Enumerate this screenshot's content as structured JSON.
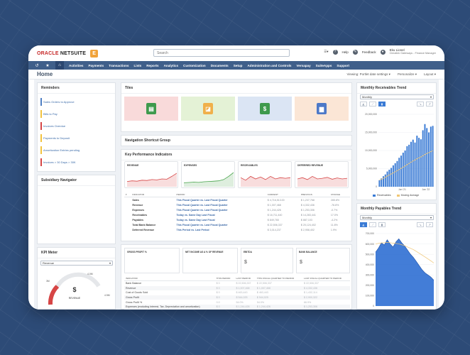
{
  "brand": {
    "oracle": "ORACLE",
    "netsuite": "NETSUITE",
    "badge": "E"
  },
  "search": {
    "placeholder": "Search"
  },
  "topbar": {
    "help": "Help",
    "feedback": "Feedback",
    "user_name": "Eku Lionel",
    "user_role": "Cimalink Gateways - Finance Manager"
  },
  "nav": {
    "items": [
      "Activities",
      "Payments",
      "Transactions",
      "Lists",
      "Reports",
      "Analytics",
      "Customization",
      "Documents",
      "Setup",
      "Administration and Controls",
      "Versapay",
      "SuiteApps",
      "Support"
    ]
  },
  "page": {
    "title": "Home",
    "actions": [
      "Viewing: Portlet date settings ▾",
      "Personalize ▾",
      "Layout ▾"
    ]
  },
  "reminders": {
    "title": "Reminders",
    "items": [
      {
        "label": "Sales Orders to Approve",
        "color": "#4f7fc4"
      },
      {
        "label": "Bills to Pay",
        "color": "#f2c33f"
      },
      {
        "label": "Invoices Overdue",
        "color": "#d64545"
      },
      {
        "label": "Payments to Deposit",
        "color": "#f2c33f"
      },
      {
        "label": "Amortization Entries pending",
        "color": "#f2c33f"
      },
      {
        "label": "Invoices > 30 Days > 30K",
        "color": "#d64545"
      }
    ]
  },
  "subsidiary": {
    "title": "Subsidiary Navigator"
  },
  "kpi_meter": {
    "title": "KPI Meter",
    "select": "Revenue",
    "value_label": "REVENUE",
    "max_label": "4.5M",
    "min_label": "3M",
    "top_label": "4.0M"
  },
  "tiles": {
    "title": "Tiles",
    "items": [
      {
        "bg": "#f9dada",
        "icon_bg": "#3f9a4d",
        "icon": "cash-register-icon"
      },
      {
        "bg": "#e4f2d6",
        "icon_bg": "#f0b04a",
        "icon": "report-chart-icon"
      },
      {
        "bg": "#dbe5f4",
        "icon_bg": "#3f9a4d",
        "icon": "money-icon"
      },
      {
        "bg": "#fbe6d6",
        "icon_bg": "#4d79c8",
        "icon": "document-icon"
      }
    ]
  },
  "nav_shortcut": {
    "title": "Navigation Shortcut Group"
  },
  "kpi": {
    "title": "Key Performance Indicators",
    "cards": [
      {
        "label": "REVENUE",
        "color": "#d64545",
        "trend": [
          0.3,
          0.35,
          0.32,
          0.4,
          0.38,
          0.45,
          0.42,
          0.5,
          0.48,
          0.7,
          0.95
        ]
      },
      {
        "label": "EXPENSES",
        "color": "#46a34a",
        "trend": [
          0.2,
          0.22,
          0.25,
          0.23,
          0.28,
          0.3,
          0.32,
          0.35,
          0.45,
          0.7,
          1.0
        ]
      },
      {
        "label": "RECEIVABLES",
        "color": "#d64545",
        "trend": [
          0.6,
          0.4,
          0.7,
          0.5,
          0.65,
          0.45,
          0.7,
          0.5,
          0.6,
          0.55,
          0.6
        ]
      },
      {
        "label": "DEFERRED REVENUE",
        "color": "#d64545",
        "trend": [
          0.5,
          0.6,
          0.45,
          0.7,
          0.5,
          0.55,
          0.62,
          0.48,
          0.58,
          0.5,
          0.55
        ]
      }
    ],
    "columns": [
      "INDICATOR",
      "PERIOD",
      "CURRENT",
      "PREVIOUS",
      "CHANGE"
    ],
    "rows": [
      {
        "indicator": "Sales",
        "period": "This Fiscal Quarter vs. Last Fiscal Quarter",
        "current": "$ 4,716,513.00",
        "previous": "$ 1,237,768",
        "change": "285.8%"
      },
      {
        "indicator": "Revenue",
        "period": "This Fiscal Quarter vs. Last Fiscal Quarter",
        "current": "$ 1,007,468",
        "previous": "$ 4,332,436",
        "change": "-76.8%"
      },
      {
        "indicator": "Expenses",
        "period": "This Fiscal Quarter vs. Last Fiscal Quarter",
        "current": "$ 1,244,426",
        "previous": "$ 1,253,306",
        "change": "-0.7%"
      },
      {
        "indicator": "Receivables",
        "period": "Today vs. Same Day Last Fiscal",
        "current": "$ 16,711,440",
        "previous": "$ 14,283,441",
        "change": "17.0%"
      },
      {
        "indicator": "Payables",
        "period": "Today vs. Same Day Last Fiscal",
        "current": "$ 849,765",
        "previous": "$ 887,103",
        "change": "-4.2%"
      },
      {
        "indicator": "Total Bank Balance",
        "period": "This Fiscal Quarter vs. Last Fiscal Quarter",
        "current": "$ 22,506,337",
        "previous": "$ 20,124,402",
        "change": "11.8%"
      },
      {
        "indicator": "Deferred Revenue",
        "period": "This Period vs. Last Period",
        "current": "$ 3,014,237",
        "previous": "$ 2,958,402",
        "change": "1.9%"
      }
    ]
  },
  "finance": {
    "cards": [
      {
        "label": "GROSS PROFIT %"
      },
      {
        "label": "NET INCOME AS A % OF REVENUE"
      },
      {
        "label": "EBITDA",
        "value": "$"
      },
      {
        "label": "BANK BALANCE",
        "value": "$"
      }
    ],
    "columns": [
      "INDICATOR",
      "THIS PERIOD",
      "LAST PERIOD",
      "THIS FISCAL QUARTER TO PERIOD",
      "LAST FISCAL QUARTER TO PERIOD"
    ],
    "rows": [
      {
        "indicator": "Bank Balance",
        "vals": [
          "$ 0",
          "$ 22,506,337",
          "$ 22,506,337",
          "$ 22,506,337"
        ]
      },
      {
        "indicator": "Revenue",
        "vals": [
          "$ 0",
          "$ 1,007,468",
          "$ 1,007,468",
          "$ 4,332,436"
        ]
      },
      {
        "indicator": "Cost of Goods Sold",
        "vals": [
          "$ 0",
          "$ 463,443",
          "$ 463,443",
          "$ 1,432,114"
        ]
      },
      {
        "indicator": "Gross Profit",
        "vals": [
          "$ 0",
          "$ 544,025",
          "$ 544,025",
          "$ 2,900,322"
        ]
      },
      {
        "indicator": "Gross Profit %",
        "vals": [
          "0.0",
          "54.0%",
          "54.0%",
          "66.9%"
        ]
      },
      {
        "indicator": "Expenses (excluding Interest, Tax, Depreciation and amortization)",
        "vals": [
          "$ 0",
          "$ 1,244,426",
          "$ 1,244,426",
          "$ 1,253,306"
        ]
      }
    ]
  },
  "receivables_trend": {
    "title": "Monthly Receivables Trend",
    "select": "Monthly",
    "legend": [
      "Receivables",
      "Moving Average"
    ],
    "bar_color": "#3a7bd5",
    "avg_color": "#f0c674"
  },
  "payables_trend": {
    "title": "Monthly Payables Trend",
    "select": "Monthly",
    "area_color": "#2f6fd3"
  },
  "chart_data": [
    {
      "type": "bar",
      "title": "Monthly Receivables Trend",
      "yticks": [
        "20,000,000",
        "15,000,000",
        "10,000,000",
        "5,000,000",
        "0"
      ],
      "xticks": [
        "Jan '21",
        "Jan '22"
      ],
      "ylim": [
        0,
        20000000
      ],
      "series": [
        {
          "name": "Receivables",
          "values": [
            1800000,
            2300000,
            2900000,
            3400000,
            4200000,
            4700000,
            5200000,
            5900000,
            6500000,
            7100000,
            8000000,
            8600000,
            9400000,
            10000000,
            11200000,
            11600000,
            12400000,
            13000000,
            12200000,
            14100000,
            13500000,
            13100000,
            15600000,
            17300000,
            16200000,
            15000000,
            16600000,
            16800000
          ]
        },
        {
          "name": "Moving Average",
          "values": [
            1800000,
            2050000,
            2333000,
            2600000,
            2960000,
            3250000,
            3530000,
            3830000,
            4130000,
            4420000,
            4750000,
            5070000,
            5400000,
            5730000,
            6100000,
            6440000,
            6780000,
            7120000,
            7380000,
            7720000,
            8000000,
            8230000,
            8550000,
            8900000,
            9190000,
            9420000,
            9690000,
            9950000
          ]
        }
      ]
    },
    {
      "type": "area",
      "title": "Monthly Payables Trend",
      "yticks": [
        "700,000",
        "600,000",
        "500,000",
        "400,000",
        "300,000",
        "200,000",
        "100,000",
        "0"
      ],
      "ylim": [
        0,
        700000
      ],
      "series": [
        {
          "name": "Payables",
          "values": [
            520000,
            560000,
            610000,
            590000,
            640000,
            600000,
            570000,
            620000,
            650000,
            610000,
            580000,
            540000,
            500000,
            470000,
            430000,
            390000,
            350000,
            320000,
            300000,
            280000,
            250000
          ]
        },
        {
          "name": "Moving Average",
          "values": [
            600000,
            605000,
            610000,
            612000,
            615000,
            612000,
            608000,
            605000,
            600000,
            592000,
            583000,
            570000,
            558000,
            545000,
            528000,
            510000,
            492000,
            474000,
            455000,
            436000,
            416000
          ]
        }
      ]
    }
  ]
}
